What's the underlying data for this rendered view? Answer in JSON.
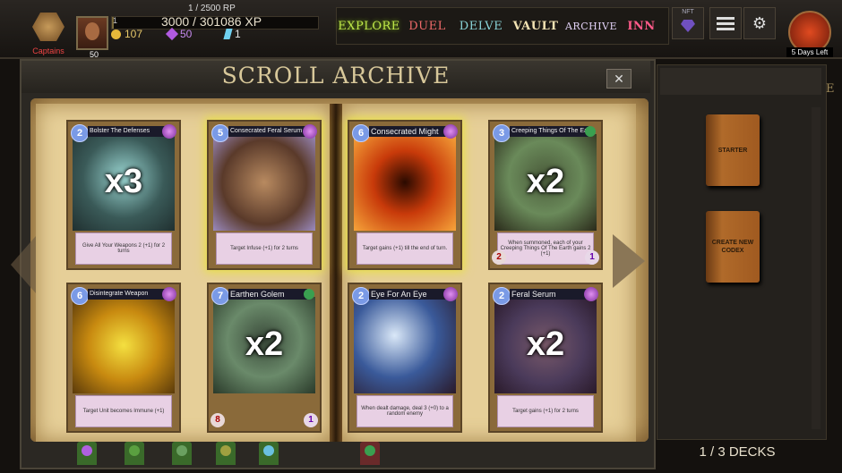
{
  "header": {
    "captains_label": "Captains",
    "player_level": "50",
    "rp_text": "1 / 2500 RP",
    "level_small": "1",
    "xp_text": "3000 / 301086 XP",
    "xp_progress": 0.01,
    "gold": "107",
    "purple_gems": "50",
    "blue_shards": "1",
    "event_label": "5 Days Left"
  },
  "nav": {
    "explore": "EXPLORE",
    "duel": "DUEL",
    "delve": "DELVE",
    "vault": "VAULT",
    "archive": "ARCHIVE",
    "inn": "INN",
    "nft": "NFT"
  },
  "panel": {
    "title": "SCROLL ARCHIVE",
    "close": "✕"
  },
  "cards": [
    {
      "cost": "2",
      "name": "Bolster The Defenses",
      "qty": "x3",
      "desc": "Give All Your Weapons 2 (+1) for 2 turns",
      "school": "arcane",
      "atk": "",
      "hp": ""
    },
    {
      "cost": "5",
      "name": "Consecrated Feral Serum",
      "qty": "",
      "desc": "Target Infuse (+1) for 2 turns",
      "school": "arcane",
      "atk": "",
      "hp": ""
    },
    {
      "cost": "6",
      "name": "Consecrated Might",
      "qty": "",
      "desc": "Target gains (+1) till the end of turn.",
      "school": "arcane",
      "atk": "",
      "hp": ""
    },
    {
      "cost": "3",
      "name": "Creeping Things Of The Earth",
      "qty": "x2",
      "desc": "When summoned, each of your Creeping Things Of The Earth gains 2 (+1)",
      "school": "nature",
      "atk": "2",
      "hp": "1"
    },
    {
      "cost": "6",
      "name": "Disintegrate Weapon",
      "qty": "",
      "desc": "Target Unit becomes Immune (+1)",
      "school": "arcane",
      "atk": "",
      "hp": ""
    },
    {
      "cost": "7",
      "name": "Earthen Golem",
      "qty": "x2",
      "desc": "",
      "school": "nature",
      "atk": "8",
      "hp": "1"
    },
    {
      "cost": "2",
      "name": "Eye For An Eye",
      "qty": "",
      "desc": "When dealt damage, deal 3 (+0) to a random enemy",
      "school": "arcane",
      "atk": "",
      "hp": ""
    },
    {
      "cost": "2",
      "name": "Feral Serum",
      "qty": "x2",
      "desc": "Target gains (+1) for 2 turns",
      "school": "arcane",
      "atk": "",
      "hp": ""
    }
  ],
  "side": {
    "deck_starter": "STARTER",
    "deck_create": "CREATE NEW CODEX",
    "decks_count": "1 / 3 DECKS",
    "edge_letter": "E"
  },
  "colors": {
    "explore": "#bfe84a",
    "duel": "#f06a6a",
    "delve": "#8ad4d8",
    "inn": "#ff5a8a",
    "title": "#d8c89a"
  }
}
